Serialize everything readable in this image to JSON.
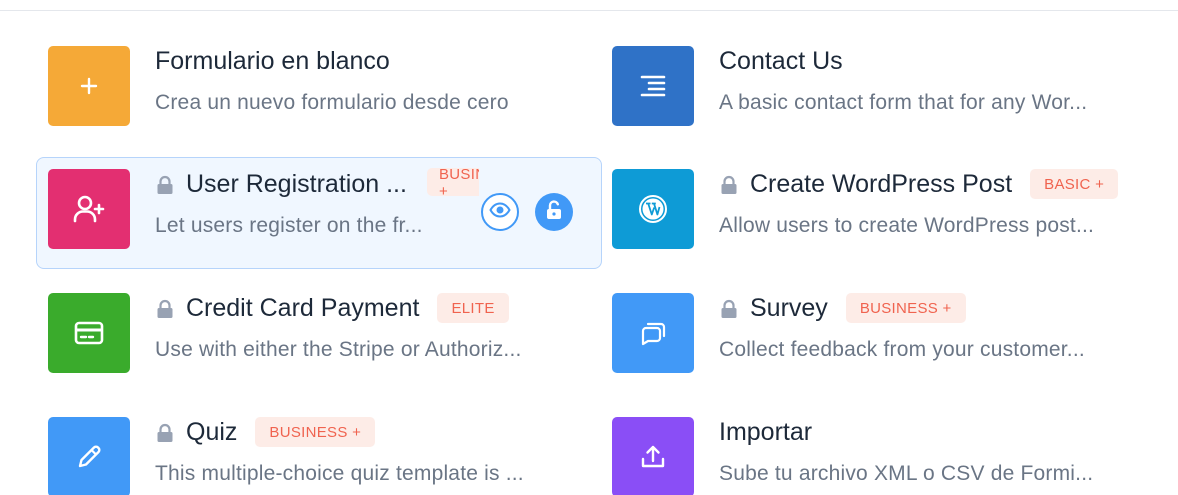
{
  "colors": {
    "orange": "#f5a937",
    "blue_dark": "#2f72c7",
    "pink": "#e32f71",
    "wp_blue": "#0e9bd6",
    "green": "#3aab2c",
    "blue": "#4199f7",
    "purple": "#8a4ef6",
    "badge_bg": "#fdece7",
    "badge_text": "#f0634f"
  },
  "templates": [
    {
      "title": "Formulario en blanco",
      "description": "Crea un nuevo formulario desde cero",
      "icon": "plus-icon",
      "locked": false,
      "badge": ""
    },
    {
      "title": "Contact Us",
      "description": "A basic contact form that for any Wor...",
      "icon": "align-right-lines-icon",
      "locked": false,
      "badge": ""
    },
    {
      "title": "User Registration ...",
      "description": "Let users register on the fr...",
      "icon": "add-user-icon",
      "locked": true,
      "badge": "BUSINESS +"
    },
    {
      "title": "Create WordPress Post",
      "description": "Allow users to create WordPress post...",
      "icon": "wordpress-icon",
      "locked": true,
      "badge": "BASIC +"
    },
    {
      "title": "Credit Card Payment",
      "description": "Use with either the Stripe or Authoriz...",
      "icon": "credit-card-icon",
      "locked": true,
      "badge": "ELITE"
    },
    {
      "title": "Survey",
      "description": "Collect feedback from your customer...",
      "icon": "chat-bubbles-icon",
      "locked": true,
      "badge": "BUSINESS +"
    },
    {
      "title": "Quiz",
      "description": "This multiple-choice quiz template is ...",
      "icon": "pencil-icon",
      "locked": true,
      "badge": "BUSINESS +"
    },
    {
      "title": "Importar",
      "description": "Sube tu archivo XML o CSV de Formi...",
      "icon": "upload-icon",
      "locked": false,
      "badge": ""
    }
  ],
  "hover_actions": {
    "preview_icon": "eye-icon",
    "unlock_icon": "unlock-icon"
  }
}
